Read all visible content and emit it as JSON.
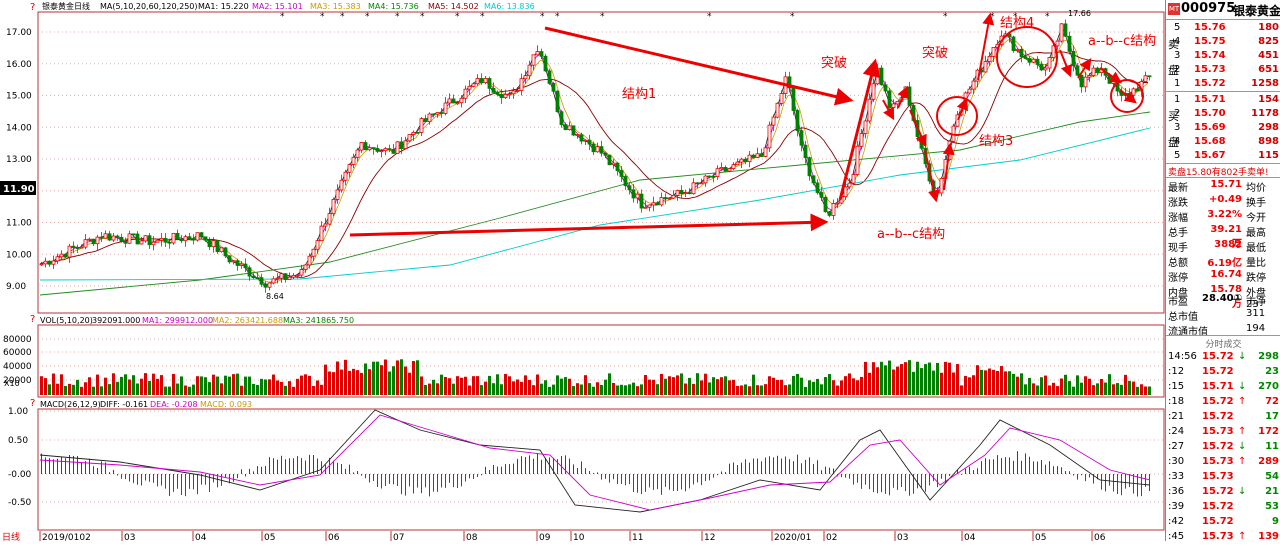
{
  "window": {
    "title": "银泰黄金日线"
  },
  "main_legend": {
    "indicator": "MA(5,10,20,60,120,250)",
    "ma1": "MA1: 15.220",
    "ma2": "MA2: 15.101",
    "ma3": "MA3: 15.383",
    "ma4": "MA4: 15.736",
    "ma5": "MA5: 14.502",
    "ma6": "MA6: 13.836"
  },
  "vol_legend": {
    "indicator": "VOL(5,10,20)",
    "vol": "392091.000",
    "ma1": "MA1: 299912.000",
    "ma2": "MA2: 263421.688",
    "ma3": "MA3: 241865.750"
  },
  "macd_legend": {
    "indicator": "MACD(26,12,9)",
    "diff": "DIFF: -0.161",
    "dea": "DEA: -0.208",
    "macd": "MACD: 0.093"
  },
  "axis": {
    "price_ticks": [
      "17.00",
      "16.00",
      "15.00",
      "14.00",
      "13.00",
      "12.00",
      "11.00",
      "10.00",
      "9.00"
    ],
    "current_price_label": "11.90",
    "vol_ticks": [
      "80000",
      "60000",
      "40000",
      "20000"
    ],
    "vol_unit": "X10",
    "macd_ticks": [
      "1.00",
      "0.50",
      "-0.00",
      "-0.50"
    ],
    "date_labels": [
      "2019/0102",
      "03",
      "04",
      "05",
      "06",
      "07",
      "08",
      "09",
      "10",
      "11",
      "12",
      "2020/01",
      "02",
      "03",
      "04",
      "05",
      "06"
    ],
    "low_marker": "8.64",
    "high_marker": "17.66",
    "bottom_left_label": "日线"
  },
  "annotations": {
    "structure1": "结构1",
    "breakout1": "突破",
    "breakout2": "突破",
    "abc1": "a--b--c结构",
    "structure3": "结构3",
    "structure4": "结构4",
    "abc2": "a--b--c结构"
  },
  "colors": {
    "up": "#e00000",
    "down": "#008000",
    "ma_light": "#00cccc",
    "ma_dark": "#8b0000",
    "ma_green": "#228b22",
    "annotation": "#e00000"
  },
  "sidebar": {
    "code": "000975",
    "name": "银泰黄金",
    "ask_label_1": "卖",
    "ask_label_2": "盘",
    "bid_label_1": "买",
    "bid_label_2": "盘",
    "asks": [
      {
        "level": "5",
        "price": "15.76",
        "vol": "180"
      },
      {
        "level": "4",
        "price": "15.75",
        "vol": "825"
      },
      {
        "level": "3",
        "price": "15.74",
        "vol": "451"
      },
      {
        "level": "2",
        "price": "15.73",
        "vol": "651"
      },
      {
        "level": "1",
        "price": "15.72",
        "vol": "1258"
      }
    ],
    "bids": [
      {
        "level": "1",
        "price": "15.71",
        "vol": "154"
      },
      {
        "level": "2",
        "price": "15.70",
        "vol": "1178"
      },
      {
        "level": "3",
        "price": "15.69",
        "vol": "298"
      },
      {
        "level": "4",
        "price": "15.68",
        "vol": "898"
      },
      {
        "level": "5",
        "price": "15.67",
        "vol": "115"
      }
    ],
    "commit_line": "卖盘15.80有802手卖单!",
    "stats": [
      {
        "k": "最新",
        "v": "15.71",
        "k2": "均价"
      },
      {
        "k": "涨跌",
        "v": "+0.49",
        "k2": "换手"
      },
      {
        "k": "涨幅",
        "v": "3.22%",
        "k2": "今开"
      },
      {
        "k": "总手",
        "v": "39.21万",
        "k2": "最高"
      },
      {
        "k": "现手",
        "v": "3882",
        "k2": "最低"
      },
      {
        "k": "总额",
        "v": "6.19亿",
        "k2": "量比"
      },
      {
        "k": "涨停",
        "v": "16.74",
        "k2": "跌停"
      },
      {
        "k": "内盘",
        "v": "15.78万",
        "k2": "外盘 23"
      }
    ],
    "extra": [
      {
        "k": "市盈",
        "v": "28.40①",
        "k2": "市净"
      },
      {
        "k": "总市值",
        "v": "",
        "k2": "311"
      },
      {
        "k": "流通市值",
        "v": "",
        "k2": "194"
      }
    ],
    "ticks_header": "分时成交",
    "ticks": [
      {
        "t": "14:56",
        "p": "15.72",
        "a": "↓",
        "q": "298",
        "c": "grn"
      },
      {
        "t": ":12",
        "p": "15.72",
        "a": "",
        "q": "23",
        "c": "grn"
      },
      {
        "t": ":15",
        "p": "15.71",
        "a": "↓",
        "q": "270",
        "c": "grn"
      },
      {
        "t": ":18",
        "p": "15.72",
        "a": "↑",
        "q": "72",
        "c": "red"
      },
      {
        "t": ":21",
        "p": "15.72",
        "a": "",
        "q": "17",
        "c": "grn"
      },
      {
        "t": ":24",
        "p": "15.73",
        "a": "↑",
        "q": "172",
        "c": "red"
      },
      {
        "t": ":27",
        "p": "15.72",
        "a": "↓",
        "q": "11",
        "c": "grn"
      },
      {
        "t": ":30",
        "p": "15.73",
        "a": "↑",
        "q": "289",
        "c": "red"
      },
      {
        "t": ":33",
        "p": "15.73",
        "a": "",
        "q": "54",
        "c": "grn"
      },
      {
        "t": ":36",
        "p": "15.72",
        "a": "↓",
        "q": "21",
        "c": "grn"
      },
      {
        "t": ":39",
        "p": "15.72",
        "a": "",
        "q": "53",
        "c": "grn"
      },
      {
        "t": ":42",
        "p": "15.72",
        "a": "",
        "q": "9",
        "c": "grn"
      },
      {
        "t": ":45",
        "p": "15.73",
        "a": "↑",
        "q": "139",
        "c": "red"
      }
    ]
  }
}
